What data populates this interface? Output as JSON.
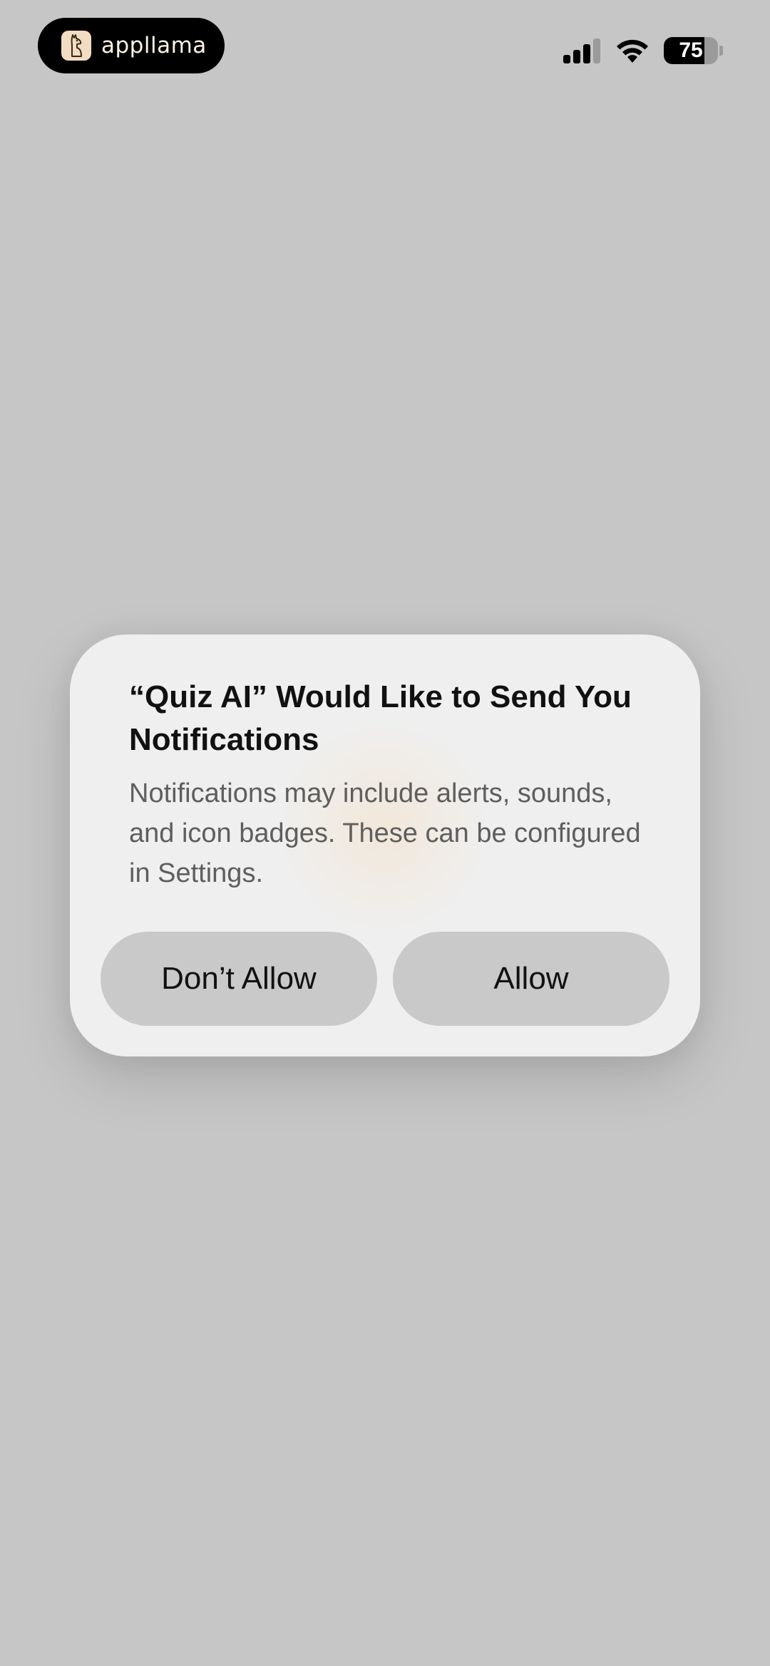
{
  "status_bar": {
    "brand_name": "appllama",
    "brand_logo_icon": "llama-icon",
    "signal_icon": "cellular-signal-icon",
    "signal_bars_active": 3,
    "signal_bars_total": 4,
    "wifi_icon": "wifi-icon",
    "battery_icon": "battery-icon",
    "battery_level": 75,
    "battery_text": "75"
  },
  "alert": {
    "title": "“Quiz AI” Would Like to Send You Notifications",
    "message": "Notifications may include alerts, sounds, and icon badges. These can be configured in Settings.",
    "buttons": {
      "dont_allow": "Don’t Allow",
      "allow": "Allow"
    }
  },
  "colors": {
    "background": "#c6c6c6",
    "alert_background": "#efefef",
    "button_background": "#c9c9c9"
  }
}
